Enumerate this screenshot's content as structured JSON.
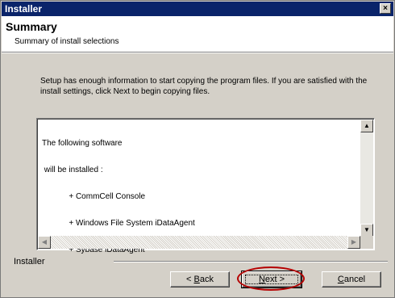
{
  "window": {
    "title": "Installer"
  },
  "header": {
    "title": "Summary",
    "subtitle": "Summary of install selections"
  },
  "intro_text": "Setup has enough information to start copying the program files. If you are satisfied with the install settings, click Next to begin copying files.",
  "summary_lines": [
    "The following software",
    " will be installed :",
    "            + CommCell Console",
    "            + Windows File System iDataAgent",
    "            + Sybase iDataAgent"
  ],
  "footer_label": "Installer",
  "buttons": {
    "back": {
      "pre": "< ",
      "mnemonic": "B",
      "rest": "ack"
    },
    "next": {
      "mnemonic": "N",
      "rest": "ext >"
    },
    "cancel": {
      "mnemonic": "C",
      "rest": "ancel"
    }
  },
  "icons": {
    "close": "×",
    "scroll_up": "▲",
    "scroll_down": "▼",
    "scroll_left": "◀",
    "scroll_right": "▶"
  },
  "colors": {
    "titlebar": "#0a246a",
    "face": "#d4d0c8",
    "annotation": "#b50000"
  }
}
